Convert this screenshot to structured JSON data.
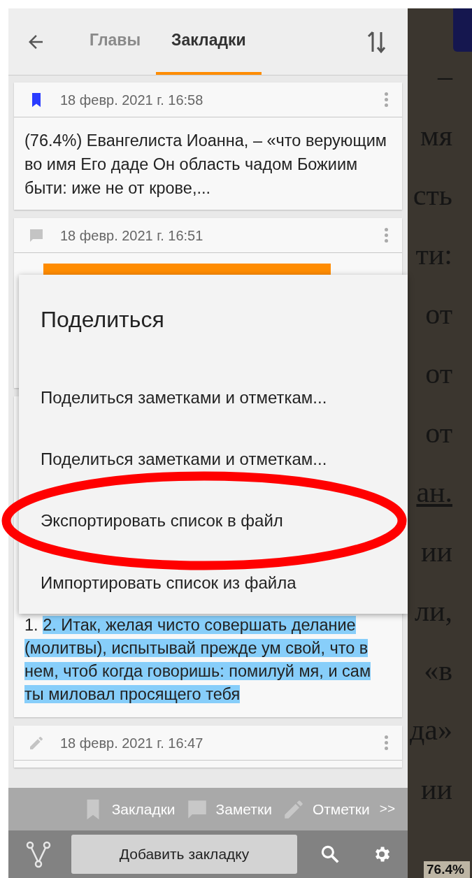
{
  "header": {
    "tabs": [
      {
        "label": "Главы",
        "selected": false
      },
      {
        "label": "Закладки",
        "selected": true
      }
    ]
  },
  "cards": [
    {
      "kind": "bookmark",
      "date": "18 февр. 2021 г. 16:58",
      "text": "(76.4%) Евангелиста Иоанна, – «что верующим во имя Его даде Он область чадом Божиим быти: иже не от крове,..."
    },
    {
      "kind": "note",
      "date": "18 февр. 2021 г. 16:51",
      "color": "#ff8c00"
    },
    {
      "kind": "continued",
      "prefix": "1. ",
      "highlight": "2. Итак, желая чисто совершать делание (молитвы), испытывай прежде ум свой, что в нем, чтоб когда говоришь: помилуй мя, и сам ты миловал просящего тебя",
      "color": "#87cefa"
    },
    {
      "kind": "mark",
      "date": "18 февр. 2021 г. 16:47"
    }
  ],
  "dialog": {
    "title": "Поделиться",
    "items": [
      "Поделиться заметками и отметкам...",
      "Поделиться заметками и отметкам...",
      "Экспортировать список в файл",
      "Импортировать список из файла"
    ]
  },
  "bottom_tabs": [
    {
      "kind": "bookmark",
      "label": "Закладки"
    },
    {
      "kind": "note",
      "label": "Заметки"
    },
    {
      "kind": "mark",
      "label": "Отметки"
    }
  ],
  "more": ">>",
  "toolbar": {
    "button": "Добавить закладку"
  },
  "book": {
    "lines": [
      {
        "text": "–",
        "underlined": false
      },
      {
        "text": "мя",
        "underlined": false
      },
      {
        "text": "сть",
        "underlined": false
      },
      {
        "text": "ти:",
        "underlined": false
      },
      {
        "text": "от",
        "underlined": false
      },
      {
        "text": "от",
        "underlined": false
      },
      {
        "text": "от",
        "underlined": false
      },
      {
        "text": "ан.",
        "underlined": true
      },
      {
        "text": "ии",
        "underlined": false
      },
      {
        "text": "ли,",
        "underlined": false
      },
      {
        "text": "«в",
        "underlined": false
      },
      {
        "text": "да»",
        "underlined": false
      },
      {
        "text": "ии",
        "underlined": false
      }
    ],
    "progress": "76.4%"
  }
}
